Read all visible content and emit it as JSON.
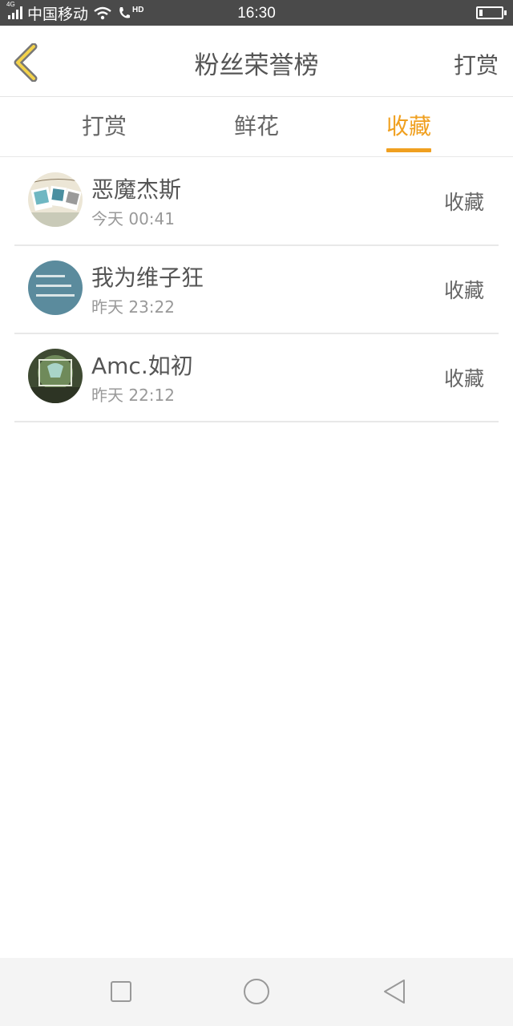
{
  "status_bar": {
    "network": "4G",
    "carrier": "中国移动",
    "call_badge": "HD",
    "time": "16:30",
    "battery_level": 0.15
  },
  "header": {
    "title": "粉丝荣誉榜",
    "action": "打赏",
    "back_icon": "chevron-left-icon",
    "accent": "#f0a020"
  },
  "tabs": [
    {
      "label": "打赏",
      "active": false
    },
    {
      "label": "鲜花",
      "active": false
    },
    {
      "label": "收藏",
      "active": true
    }
  ],
  "fans": [
    {
      "name": "恶魔杰斯",
      "time": "今天 00:41",
      "action": "收藏"
    },
    {
      "name": "我为维子狂",
      "time": "昨天 23:22",
      "action": "收藏"
    },
    {
      "name": "Amc.如初",
      "time": "昨天 22:12",
      "action": "收藏"
    }
  ],
  "nav": {
    "icons": [
      "square-icon",
      "circle-icon",
      "triangle-back-icon"
    ]
  }
}
